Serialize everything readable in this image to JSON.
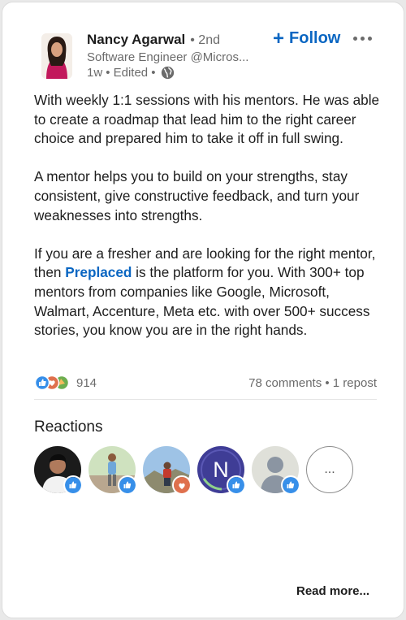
{
  "author": {
    "name": "Nancy Agarwal",
    "degree": "• 2nd",
    "headline": "Software Engineer @Micros...",
    "time": "1w",
    "edited": "• Edited •",
    "follow_label": "Follow",
    "follow_icon": "plus-icon",
    "more_icon": "ellipsis-icon"
  },
  "post": {
    "paragraph1": "With weekly 1:1 sessions with his mentors. He was able to create a roadmap that lead him to the right career choice and prepared him to take it off in full swing.",
    "paragraph2": "A mentor helps you to build on your strengths, stay consistent, give constructive feedback, and turn your weaknesses into strengths.",
    "paragraph3_before": "If you are a fresher and are looking for the right mentor, then ",
    "paragraph3_link": "Preplaced",
    "paragraph3_after": " is the platform for you. With 300+ top mentors from companies like Google, Microsoft, Walmart, Accenture, Meta etc. with over 500+ success stories, you know you are in the right hands."
  },
  "social": {
    "reaction_count": "914",
    "comments_reposts": "78 comments • 1 repost",
    "reaction_icons": [
      "like-icon",
      "love-icon",
      "celebrate-icon"
    ]
  },
  "reactions": {
    "title": "Reactions",
    "people": [
      {
        "badge": "like-icon"
      },
      {
        "badge": "like-icon"
      },
      {
        "badge": "love-icon"
      },
      {
        "initial": "N",
        "badge": "like-icon"
      },
      {
        "badge": "like-icon"
      }
    ],
    "more_label": "..."
  },
  "footer": {
    "read_more": "Read more..."
  },
  "colors": {
    "brand_blue": "#0a66c2",
    "love_red": "#df704d",
    "text_gray": "#6b6b6b"
  }
}
